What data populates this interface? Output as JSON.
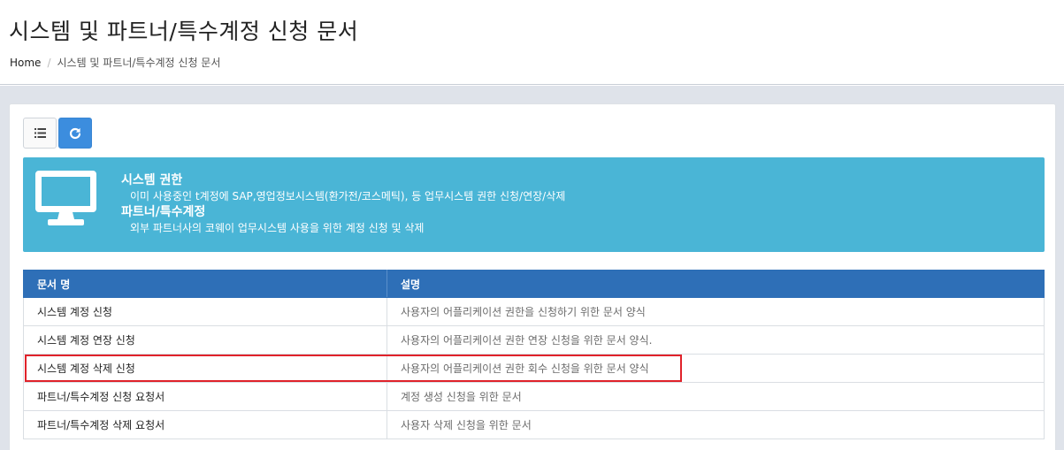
{
  "header": {
    "title": "시스템 및 파트너/특수계정 신청 문서",
    "breadcrumb": {
      "home": "Home",
      "current": "시스템 및 파트너/특수계정 신청 문서"
    }
  },
  "toolbar": {
    "list_icon": "list-icon",
    "refresh_icon": "refresh-icon"
  },
  "info_box": {
    "icon": "monitor-icon",
    "items": [
      {
        "title": "시스템 권한",
        "description": "이미 사용중인 t계정에 SAP,영업정보시스템(환가전/코스메틱), 등 업무시스템 권한 신청/연장/삭제"
      },
      {
        "title": "파트너/특수계정",
        "description": "외부 파트너사의 코웨이 업무시스템 사용을 위한 계정 신청 및 삭제"
      }
    ]
  },
  "table": {
    "columns": [
      "문서 명",
      "설명"
    ],
    "rows": [
      {
        "name": "시스템 계정 신청",
        "description": "사용자의 어플리케이션 권한을 신청하기 위한 문서 양식"
      },
      {
        "name": "시스템 계정 연장 신청",
        "description": "사용자의 어플리케이션 권한 연장 신청을 위한 문서 양식."
      },
      {
        "name": "시스템 계정 삭제 신청",
        "description": "사용자의 어플리케이션 권한 회수 신청을 위한 문서 양식"
      },
      {
        "name": "파트너/특수계정 신청 요청서",
        "description": "계정 생성 신청을 위한 문서"
      },
      {
        "name": "파트너/특수계정 삭제 요청서",
        "description": "사용자 삭제 신청을 위한 문서"
      }
    ]
  },
  "colors": {
    "info_box": "#4ab5d6",
    "table_header": "#2e6fb7",
    "refresh_button": "#3c8dde",
    "highlight": "#e0222a",
    "content_background": "#dfe3ea"
  }
}
